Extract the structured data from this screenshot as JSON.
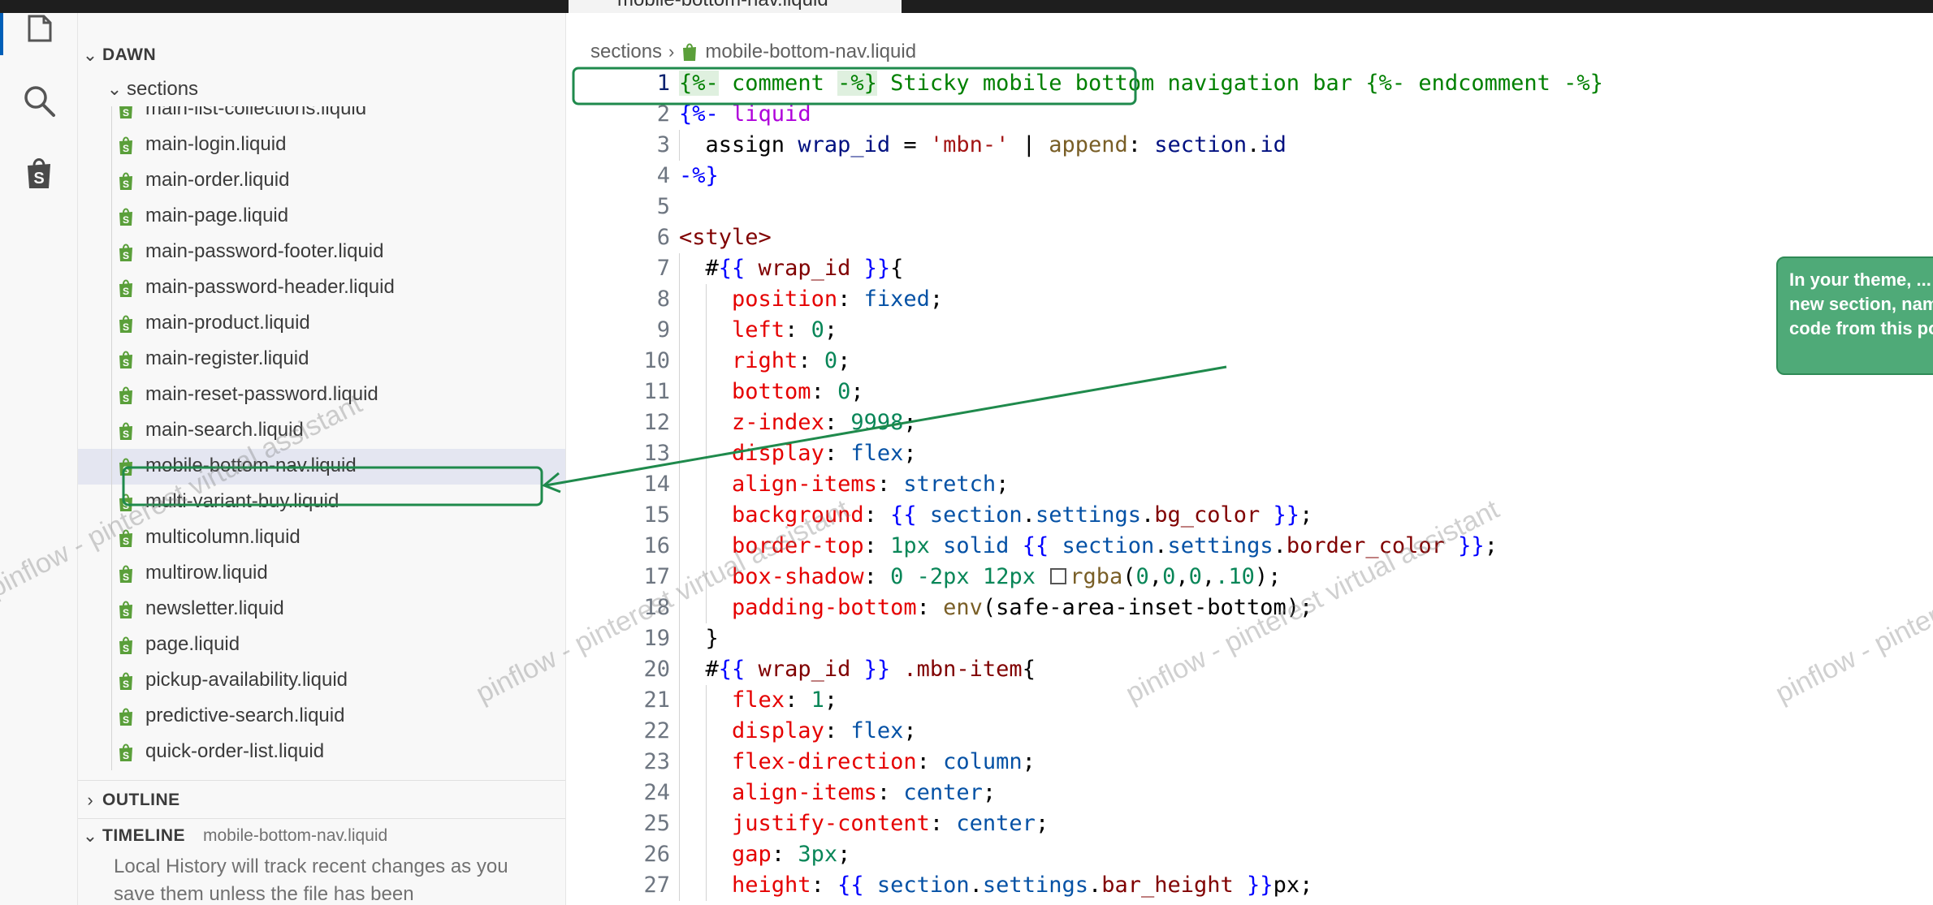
{
  "tab": {
    "label": "mobile-bottom-nav.liquid"
  },
  "activity_bar": {
    "items": [
      {
        "name": "explorer",
        "icon": "files-icon",
        "active": true
      },
      {
        "name": "search",
        "icon": "search-icon",
        "active": false
      },
      {
        "name": "shopify",
        "icon": "shopify-icon",
        "active": false
      }
    ]
  },
  "sidebar": {
    "workspace": "DAWN",
    "folder": "sections",
    "files": [
      "main-list-collections.liquid",
      "main-login.liquid",
      "main-order.liquid",
      "main-page.liquid",
      "main-password-footer.liquid",
      "main-password-header.liquid",
      "main-product.liquid",
      "main-register.liquid",
      "main-reset-password.liquid",
      "main-search.liquid",
      "mobile-bottom-nav.liquid",
      "multi-variant-buy.liquid",
      "multicolumn.liquid",
      "multirow.liquid",
      "newsletter.liquid",
      "page.liquid",
      "pickup-availability.liquid",
      "predictive-search.liquid",
      "quick-order-list.liquid"
    ],
    "selected_index": 10,
    "outline_title": "OUTLINE",
    "timeline_title": "TIMELINE",
    "timeline_file": "mobile-bottom-nav.liquid",
    "timeline_text": "Local History will track recent changes as you save them unless the file has been"
  },
  "editor": {
    "breadcrumb": [
      "sections",
      "mobile-bottom-nav.liquid"
    ],
    "active_line": 1,
    "lines": [
      {
        "n": "1",
        "indent": 0,
        "tokens": [
          [
            "{%-",
            "delim-hl"
          ],
          [
            " comment ",
            "cmt"
          ],
          [
            "-%}",
            "delim-hl"
          ],
          [
            " Sticky mobile bottom navigation bar ",
            "cmt"
          ],
          [
            "{%- endcomment -%}",
            "cmt"
          ]
        ]
      },
      {
        "n": "2",
        "indent": 0,
        "tokens": [
          [
            "{%-",
            "delim"
          ],
          [
            " liquid",
            "kw"
          ]
        ]
      },
      {
        "n": "3",
        "indent": 1,
        "tokens": [
          [
            "assign",
            "plain"
          ],
          [
            " ",
            "plain"
          ],
          [
            "wrap_id",
            "var"
          ],
          [
            " = ",
            "plain"
          ],
          [
            "'mbn-'",
            "str"
          ],
          [
            " | ",
            "plain"
          ],
          [
            "append",
            "fn"
          ],
          [
            ": ",
            "plain"
          ],
          [
            "section",
            "var"
          ],
          [
            ".",
            "plain"
          ],
          [
            "id",
            "var"
          ]
        ]
      },
      {
        "n": "4",
        "indent": 0,
        "tokens": [
          [
            "-%}",
            "delim"
          ]
        ]
      },
      {
        "n": "5",
        "indent": 0,
        "tokens": []
      },
      {
        "n": "6",
        "indent": 0,
        "tokens": [
          [
            "<style>",
            "tag"
          ]
        ]
      },
      {
        "n": "7",
        "indent": 1,
        "tokens": [
          [
            "#",
            "plain"
          ],
          [
            "{{",
            "brace"
          ],
          [
            " wrap_id ",
            "tag"
          ],
          [
            "}}",
            "brace"
          ],
          [
            "{",
            "plain"
          ]
        ]
      },
      {
        "n": "8",
        "indent": 2,
        "tokens": [
          [
            "position",
            "prop"
          ],
          [
            ": ",
            "plain"
          ],
          [
            "fixed",
            "val"
          ],
          [
            ";",
            "plain"
          ]
        ]
      },
      {
        "n": "9",
        "indent": 2,
        "tokens": [
          [
            "left",
            "prop"
          ],
          [
            ": ",
            "plain"
          ],
          [
            "0",
            "num"
          ],
          [
            ";",
            "plain"
          ]
        ]
      },
      {
        "n": "10",
        "indent": 2,
        "tokens": [
          [
            "right",
            "prop"
          ],
          [
            ": ",
            "plain"
          ],
          [
            "0",
            "num"
          ],
          [
            ";",
            "plain"
          ]
        ]
      },
      {
        "n": "11",
        "indent": 2,
        "tokens": [
          [
            "bottom",
            "prop"
          ],
          [
            ": ",
            "plain"
          ],
          [
            "0",
            "num"
          ],
          [
            ";",
            "plain"
          ]
        ]
      },
      {
        "n": "12",
        "indent": 2,
        "tokens": [
          [
            "z-index",
            "prop"
          ],
          [
            ": ",
            "plain"
          ],
          [
            "9998",
            "num"
          ],
          [
            ";",
            "plain"
          ]
        ]
      },
      {
        "n": "13",
        "indent": 2,
        "tokens": [
          [
            "display",
            "prop"
          ],
          [
            ": ",
            "plain"
          ],
          [
            "flex",
            "val"
          ],
          [
            ";",
            "plain"
          ]
        ]
      },
      {
        "n": "14",
        "indent": 2,
        "tokens": [
          [
            "align-items",
            "prop"
          ],
          [
            ": ",
            "plain"
          ],
          [
            "stretch",
            "val"
          ],
          [
            ";",
            "plain"
          ]
        ]
      },
      {
        "n": "15",
        "indent": 2,
        "tokens": [
          [
            "background",
            "prop"
          ],
          [
            ": ",
            "plain"
          ],
          [
            "{{",
            "brace"
          ],
          [
            " section",
            "val"
          ],
          [
            ".",
            "plain"
          ],
          [
            "settings",
            "val"
          ],
          [
            ".",
            "plain"
          ],
          [
            "bg_color",
            "tag"
          ],
          [
            " }}",
            "brace"
          ],
          [
            ";",
            "plain"
          ]
        ]
      },
      {
        "n": "16",
        "indent": 2,
        "tokens": [
          [
            "border-top",
            "prop"
          ],
          [
            ": ",
            "plain"
          ],
          [
            "1px",
            "num"
          ],
          [
            " ",
            "plain"
          ],
          [
            "solid",
            "val"
          ],
          [
            " ",
            "plain"
          ],
          [
            "{{",
            "brace"
          ],
          [
            " section",
            "val"
          ],
          [
            ".",
            "plain"
          ],
          [
            "settings",
            "val"
          ],
          [
            ".",
            "plain"
          ],
          [
            "border_color",
            "tag"
          ],
          [
            " }}",
            "brace"
          ],
          [
            ";",
            "plain"
          ]
        ]
      },
      {
        "n": "17",
        "indent": 2,
        "tokens": [
          [
            "box-shadow",
            "prop"
          ],
          [
            ": ",
            "plain"
          ],
          [
            "0",
            "num"
          ],
          [
            " ",
            "plain"
          ],
          [
            "-2px",
            "num"
          ],
          [
            " ",
            "plain"
          ],
          [
            "12px",
            "num"
          ],
          [
            " ",
            "plain"
          ],
          [
            "",
            "swatch"
          ],
          [
            "rgba",
            "fn"
          ],
          [
            "(",
            "plain"
          ],
          [
            "0",
            "num"
          ],
          [
            ",",
            "plain"
          ],
          [
            "0",
            "num"
          ],
          [
            ",",
            "plain"
          ],
          [
            "0",
            "num"
          ],
          [
            ",",
            "plain"
          ],
          [
            ".10",
            "num"
          ],
          [
            ");",
            "plain"
          ]
        ]
      },
      {
        "n": "18",
        "indent": 2,
        "tokens": [
          [
            "padding-bottom",
            "prop"
          ],
          [
            ": ",
            "plain"
          ],
          [
            "env",
            "fn"
          ],
          [
            "(",
            "plain"
          ],
          [
            "safe-area-inset-bottom",
            "plain"
          ],
          [
            ");",
            "plain"
          ]
        ]
      },
      {
        "n": "19",
        "indent": 1,
        "tokens": [
          [
            "}",
            "plain"
          ]
        ]
      },
      {
        "n": "20",
        "indent": 1,
        "tokens": [
          [
            "#",
            "plain"
          ],
          [
            "{{",
            "brace"
          ],
          [
            " wrap_id ",
            "tag"
          ],
          [
            "}}",
            "brace"
          ],
          [
            " .mbn-item",
            "tag"
          ],
          [
            "{",
            "plain"
          ]
        ]
      },
      {
        "n": "21",
        "indent": 2,
        "tokens": [
          [
            "flex",
            "prop"
          ],
          [
            ": ",
            "plain"
          ],
          [
            "1",
            "num"
          ],
          [
            ";",
            "plain"
          ]
        ]
      },
      {
        "n": "22",
        "indent": 2,
        "tokens": [
          [
            "display",
            "prop"
          ],
          [
            ": ",
            "plain"
          ],
          [
            "flex",
            "val"
          ],
          [
            ";",
            "plain"
          ]
        ]
      },
      {
        "n": "23",
        "indent": 2,
        "tokens": [
          [
            "flex-direction",
            "prop"
          ],
          [
            ": ",
            "plain"
          ],
          [
            "column",
            "val"
          ],
          [
            ";",
            "plain"
          ]
        ]
      },
      {
        "n": "24",
        "indent": 2,
        "tokens": [
          [
            "align-items",
            "prop"
          ],
          [
            ": ",
            "plain"
          ],
          [
            "center",
            "val"
          ],
          [
            ";",
            "plain"
          ]
        ]
      },
      {
        "n": "25",
        "indent": 2,
        "tokens": [
          [
            "justify-content",
            "prop"
          ],
          [
            ": ",
            "plain"
          ],
          [
            "center",
            "val"
          ],
          [
            ";",
            "plain"
          ]
        ]
      },
      {
        "n": "26",
        "indent": 2,
        "tokens": [
          [
            "gap",
            "prop"
          ],
          [
            ": ",
            "plain"
          ],
          [
            "3px",
            "num"
          ],
          [
            ";",
            "plain"
          ]
        ]
      },
      {
        "n": "27",
        "indent": 2,
        "tokens": [
          [
            "height",
            "prop"
          ],
          [
            ": ",
            "plain"
          ],
          [
            "{{",
            "brace"
          ],
          [
            " section",
            "val"
          ],
          [
            ".",
            "plain"
          ],
          [
            "settings",
            "val"
          ],
          [
            ".",
            "plain"
          ],
          [
            "bar_height",
            "tag"
          ],
          [
            " }}",
            "brace"
          ],
          [
            "px;",
            "plain"
          ]
        ]
      }
    ]
  },
  "annotation": {
    "text": "In your theme, ... menu > Edit code. Open the Sections folder, click Add a new section, name it mobile-bottom-nav, delete the starter code, paste the code from this post, then Save.",
    "color": "#4faa78",
    "outline_color": "#1f8a4c"
  },
  "watermark": {
    "text": "pinflow - pinterest virtual assistant"
  },
  "colors": {
    "accent": "#005fb8",
    "selection": "#e4e6f1",
    "shopify": "#5a9f3a"
  }
}
